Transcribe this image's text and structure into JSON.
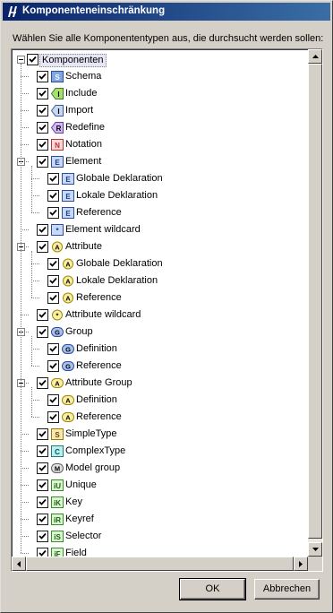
{
  "window": {
    "title": "Komponenteneinschränkung"
  },
  "prompt": "Wählen Sie alle Komponententypen aus, die durchsucht werden sollen:",
  "tree": [
    {
      "label": "Komponenten",
      "level": 0,
      "expander": true,
      "icon": "none",
      "checked": true,
      "selected": true
    },
    {
      "label": "Schema",
      "level": 1,
      "icon": "schema-icon",
      "checked": true
    },
    {
      "label": "Include",
      "level": 1,
      "icon": "include-icon",
      "checked": true
    },
    {
      "label": "Import",
      "level": 1,
      "icon": "import-icon",
      "checked": true
    },
    {
      "label": "Redefine",
      "level": 1,
      "icon": "redefine-icon",
      "checked": true
    },
    {
      "label": "Notation",
      "level": 1,
      "icon": "notation-icon",
      "checked": true
    },
    {
      "label": "Element",
      "level": 1,
      "expander": true,
      "icon": "element-icon",
      "checked": true
    },
    {
      "label": "Globale Deklaration",
      "level": 2,
      "icon": "element-icon",
      "checked": true
    },
    {
      "label": "Lokale Deklaration",
      "level": 2,
      "icon": "element-icon",
      "checked": true
    },
    {
      "label": "Reference",
      "level": 2,
      "icon": "element-icon",
      "checked": true
    },
    {
      "label": "Element wildcard",
      "level": 1,
      "icon": "element-wildcard-icon",
      "checked": true
    },
    {
      "label": "Attribute",
      "level": 1,
      "expander": true,
      "icon": "attribute-icon",
      "checked": true
    },
    {
      "label": "Globale Deklaration",
      "level": 2,
      "icon": "attribute-icon",
      "checked": true
    },
    {
      "label": "Lokale Deklaration",
      "level": 2,
      "icon": "attribute-icon",
      "checked": true
    },
    {
      "label": "Reference",
      "level": 2,
      "icon": "attribute-icon",
      "checked": true
    },
    {
      "label": "Attribute wildcard",
      "level": 1,
      "icon": "attribute-wildcard-icon",
      "checked": true
    },
    {
      "label": "Group",
      "level": 1,
      "expander": true,
      "icon": "group-icon",
      "checked": true
    },
    {
      "label": "Definition",
      "level": 2,
      "icon": "group-icon",
      "checked": true
    },
    {
      "label": "Reference",
      "level": 2,
      "icon": "group-icon",
      "checked": true
    },
    {
      "label": "Attribute Group",
      "level": 1,
      "expander": true,
      "icon": "attribute-group-icon",
      "checked": true
    },
    {
      "label": "Definition",
      "level": 2,
      "icon": "attribute-group-icon",
      "checked": true
    },
    {
      "label": "Reference",
      "level": 2,
      "icon": "attribute-group-icon",
      "checked": true
    },
    {
      "label": "SimpleType",
      "level": 1,
      "icon": "simpletype-icon",
      "checked": true
    },
    {
      "label": "ComplexType",
      "level": 1,
      "icon": "complextype-icon",
      "checked": true
    },
    {
      "label": "Model group",
      "level": 1,
      "icon": "model-group-icon",
      "checked": true
    },
    {
      "label": "Unique",
      "level": 1,
      "icon": "unique-icon",
      "checked": true
    },
    {
      "label": "Key",
      "level": 1,
      "icon": "key-icon",
      "checked": true
    },
    {
      "label": "Keyref",
      "level": 1,
      "icon": "keyref-icon",
      "checked": true
    },
    {
      "label": "Selector",
      "level": 1,
      "icon": "selector-icon",
      "checked": true
    },
    {
      "label": "Field",
      "level": 1,
      "icon": "field-icon",
      "checked": true
    }
  ],
  "buttons": {
    "ok": "OK",
    "cancel": "Abbrechen"
  }
}
